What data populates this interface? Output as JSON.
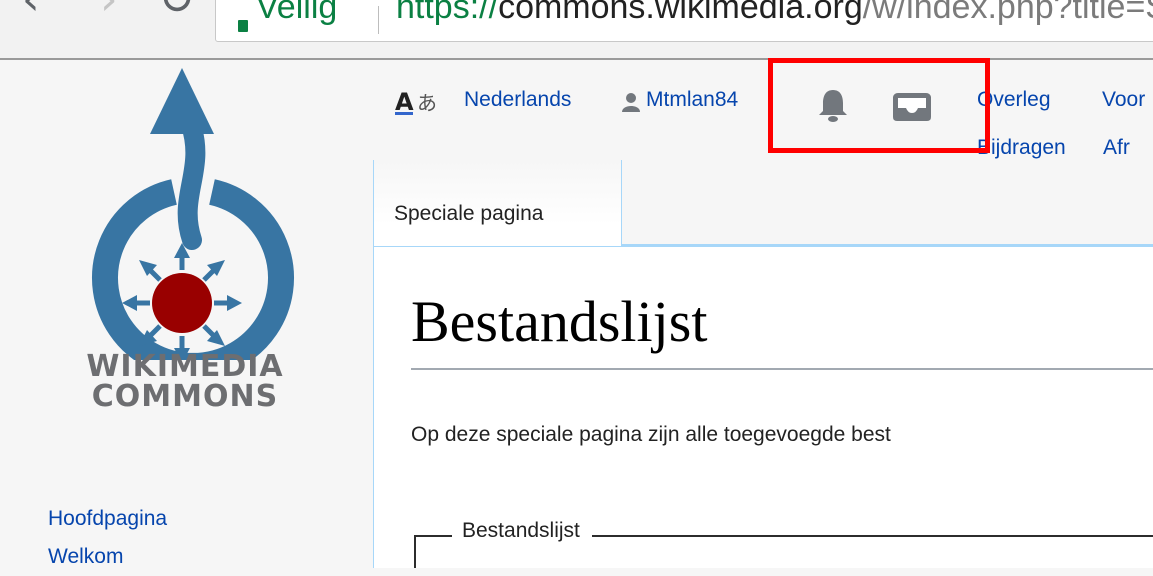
{
  "browser": {
    "back_glyph": "‹",
    "forward_glyph": "›",
    "reload_glyph": "↻",
    "secure_label": "Veilig",
    "url_scheme": "https://",
    "url_host": "commons.wikimedia.org",
    "url_path": "/w/index.php?title=S"
  },
  "logo": {
    "line1": "WIKIMEDIA",
    "line2": "COMMONS"
  },
  "sidebar": {
    "items": [
      {
        "label": "Hoofdpagina"
      },
      {
        "label": "Welkom"
      }
    ]
  },
  "personal_tools": {
    "language_label": "Nederlands",
    "username": "Mtmlan84",
    "talk": "Overleg",
    "preferences": "Voor",
    "contributions": "Bijdragen",
    "logout": "Afr"
  },
  "tabs": [
    {
      "label": "Speciale pagina"
    }
  ],
  "content": {
    "title": "Bestandslijst",
    "intro": "Op deze speciale pagina zijn alle toegevoegde best",
    "fieldset_legend": "Bestandslijst"
  },
  "colors": {
    "link": "#0645ad",
    "logo_blue": "#3875a3",
    "logo_red": "#990000",
    "highlight": "#ff0000",
    "tab_border": "#a7d7f9",
    "secure_green": "#0b8043"
  },
  "icons": {
    "language": "translate-icon",
    "user": "user-icon",
    "notifications": "bell-icon",
    "notices": "tray-icon"
  }
}
